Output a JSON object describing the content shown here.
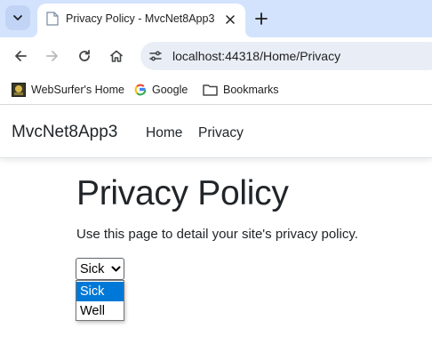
{
  "browser": {
    "tab": {
      "title": "Privacy Policy - MvcNet8App3"
    },
    "address_bar": {
      "url": "localhost:44318/Home/Privacy"
    },
    "bookmarks": [
      {
        "label": "WebSurfer's Home",
        "icon": "websurfer-favicon-icon"
      },
      {
        "label": "Google",
        "icon": "google-g-icon"
      },
      {
        "label": "Bookmarks",
        "icon": "folder-icon"
      }
    ]
  },
  "page": {
    "navbar": {
      "brand": "MvcNet8App3",
      "links": [
        "Home",
        "Privacy"
      ]
    },
    "heading": "Privacy Policy",
    "lead": "Use this page to detail your site's privacy policy.",
    "select": {
      "value": "Sick",
      "options": [
        "Sick",
        "Well"
      ],
      "highlighted_option": "Sick"
    }
  },
  "colors": {
    "tabstrip_bg": "#d3e3fd",
    "omnibox_bg": "#e9eef6",
    "option_highlight": "#0078d7",
    "text": "#212529"
  }
}
